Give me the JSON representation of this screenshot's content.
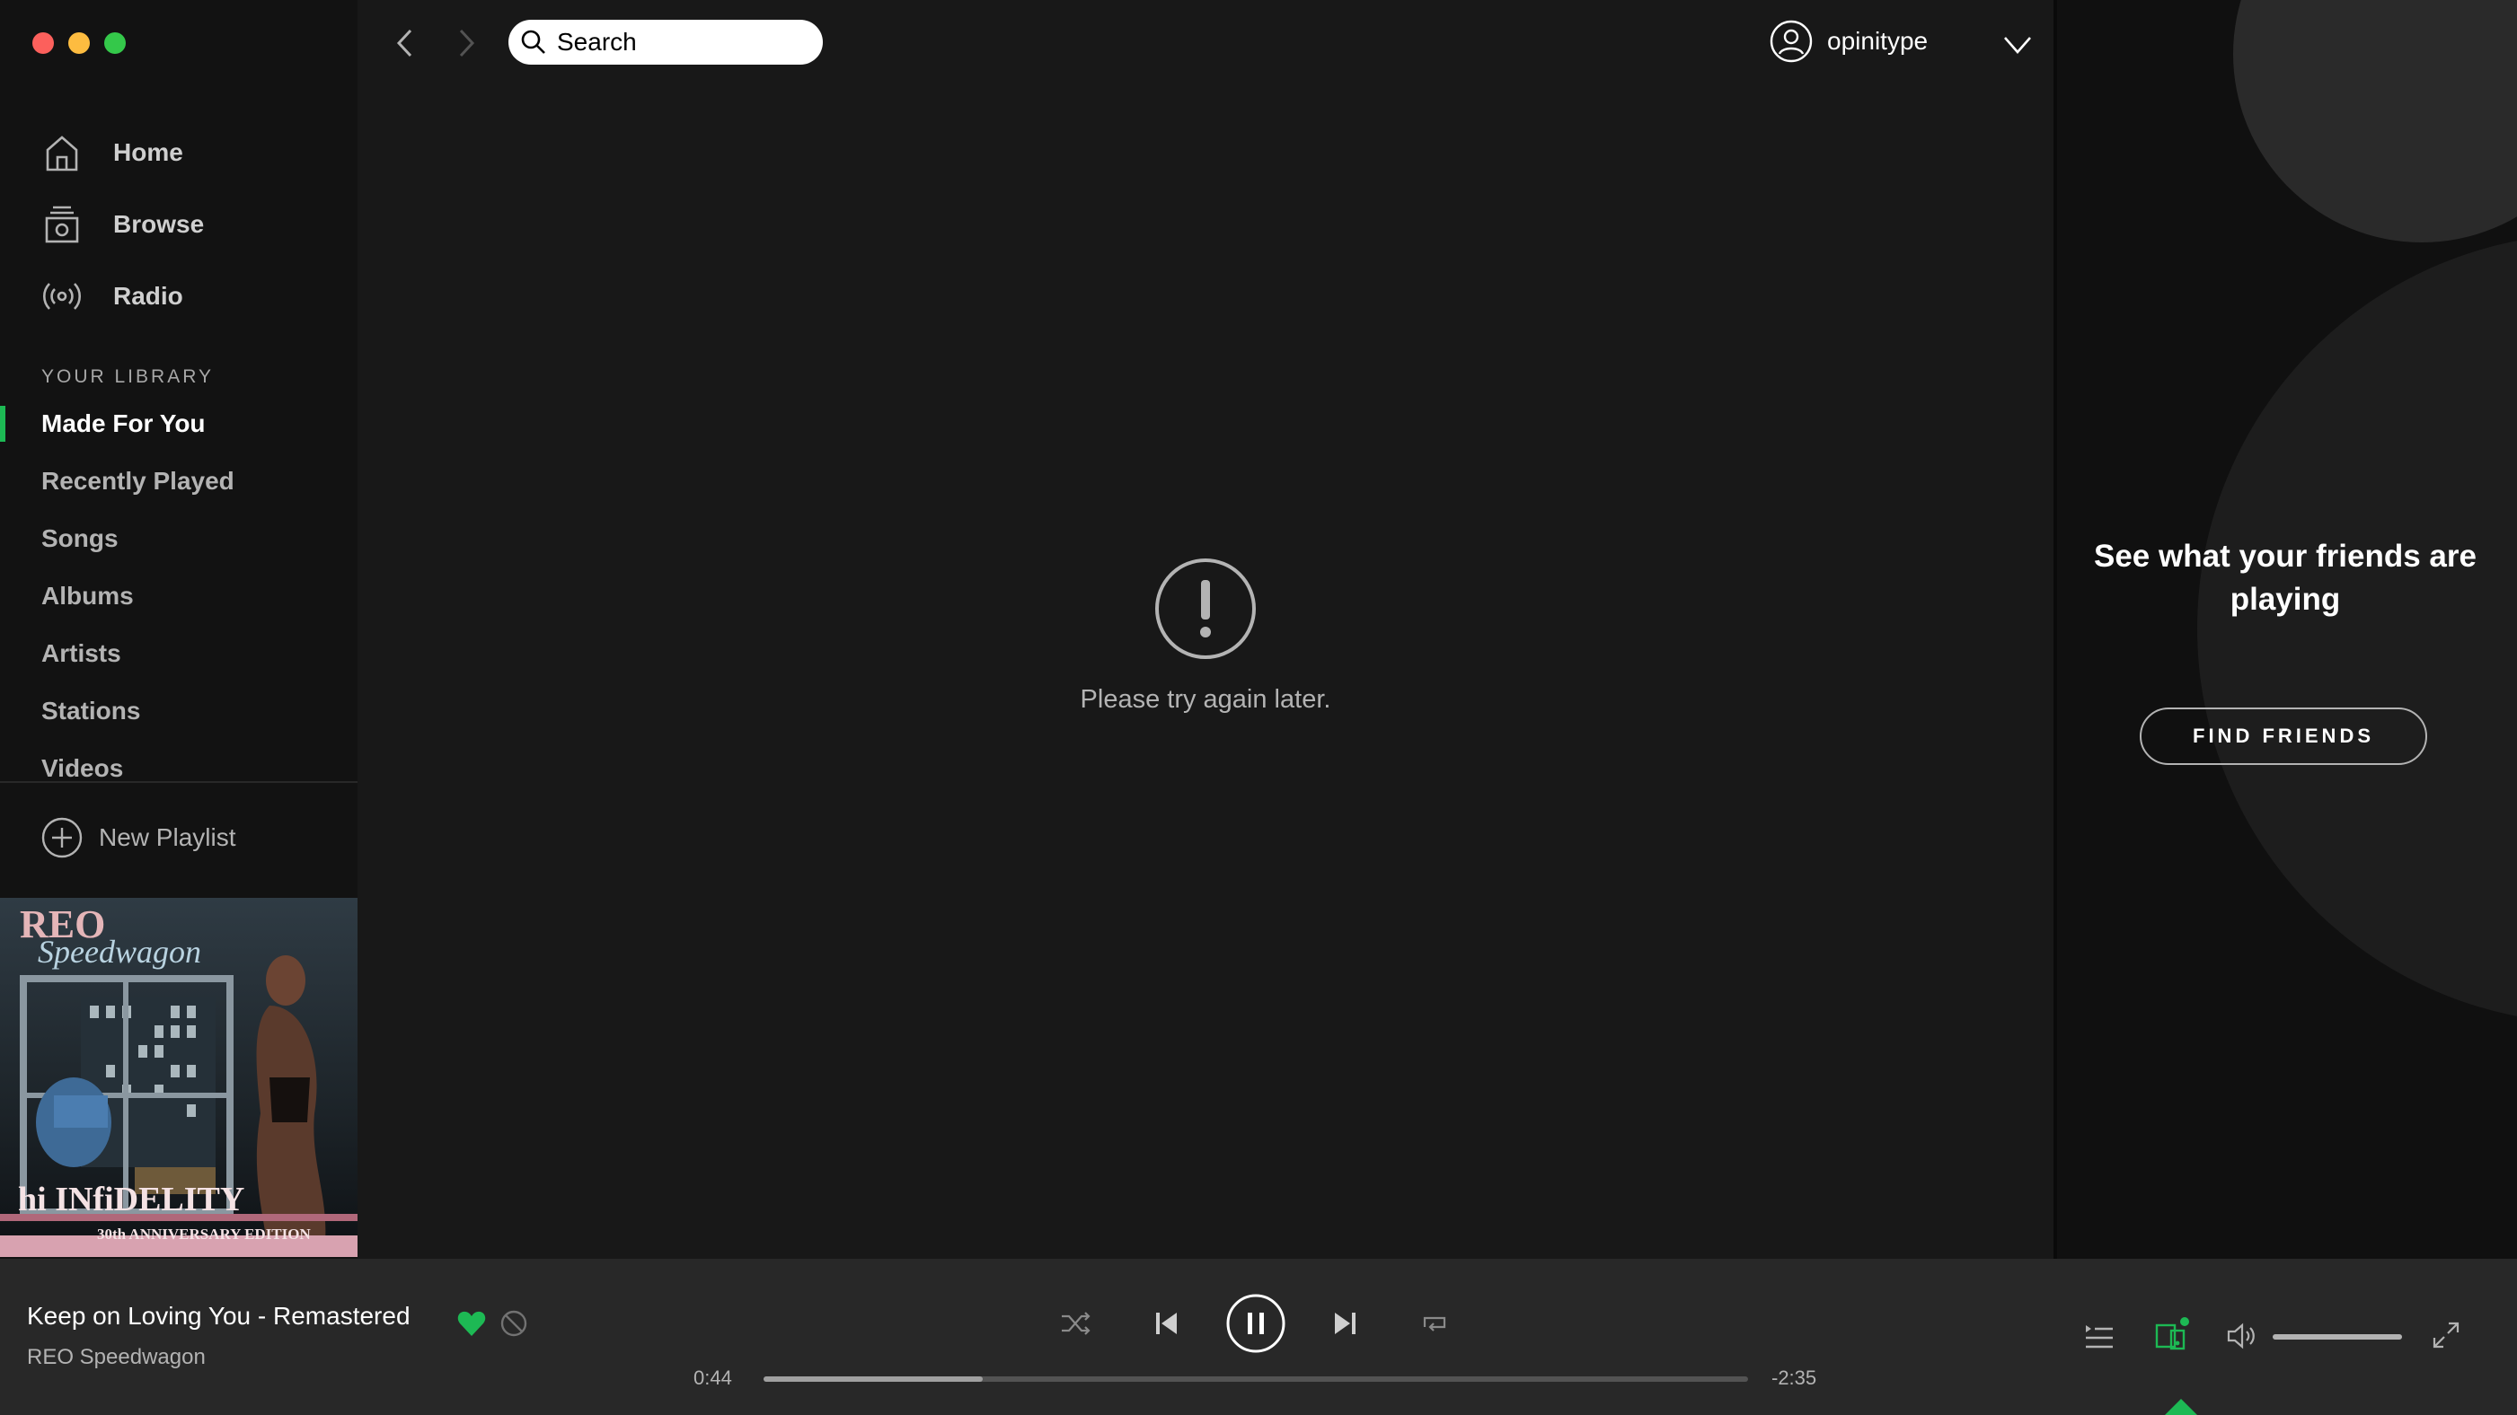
{
  "sidebar": {
    "nav": [
      {
        "label": "Home",
        "icon": "home-icon"
      },
      {
        "label": "Browse",
        "icon": "browse-icon"
      },
      {
        "label": "Radio",
        "icon": "radio-icon"
      }
    ],
    "library_header": "YOUR LIBRARY",
    "library": [
      {
        "label": "Made For You",
        "active": true
      },
      {
        "label": "Recently Played"
      },
      {
        "label": "Songs"
      },
      {
        "label": "Albums"
      },
      {
        "label": "Artists"
      },
      {
        "label": "Stations"
      },
      {
        "label": "Videos"
      }
    ],
    "new_playlist_label": "New Playlist",
    "cover_art": {
      "band_text": "REO",
      "band_script": "Speedwagon",
      "album_title": "hi INfiDELITY",
      "edition": "30th ANNIVERSARY EDITION"
    }
  },
  "topbar": {
    "search_placeholder": "Search",
    "username": "opinitype"
  },
  "main": {
    "error_message": "Please try again later."
  },
  "friends": {
    "title": "See what your friends are playing",
    "button_label": "FIND FRIENDS"
  },
  "player": {
    "track_name": "Keep on Loving You - Remastered",
    "artist": "REO Speedwagon",
    "elapsed": "0:44",
    "remaining": "-2:35",
    "progress_fraction": 0.223,
    "volume_fraction": 1.0,
    "liked": true,
    "playing": true
  },
  "colors": {
    "accent": "#1db954",
    "background": "#121212",
    "main_background": "#181818",
    "player_background": "#282828"
  }
}
